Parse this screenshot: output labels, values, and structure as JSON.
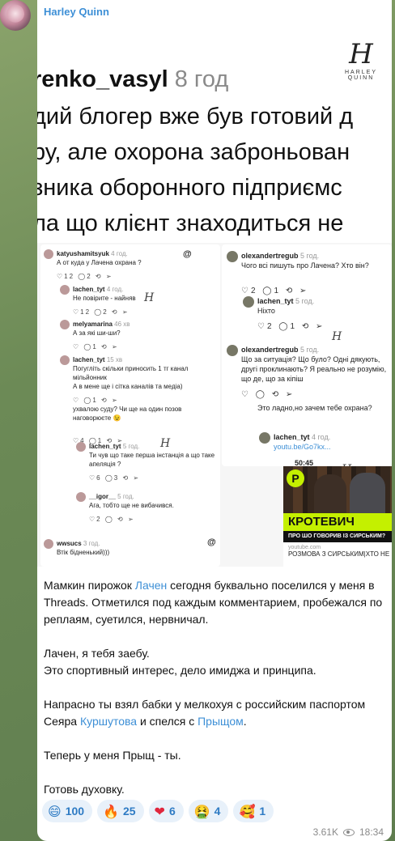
{
  "message": {
    "sender": "Harley Quinn",
    "views": "3.61K",
    "time": "18:34",
    "paragraphs": [
      {
        "parts": [
          "Мамкин пирожок ",
          "Лачен",
          " сегодня буквально поселился у меня в Threads. Отметился под каждым комментарием, пробежался по реплаям, суетился, нервничал."
        ]
      },
      {
        "lines": [
          "Лачен, я тебя заебу.",
          "Это спортивный интерес, дело имиджа и принципа."
        ]
      },
      {
        "parts": [
          "Напрасно ты взял бабки у мелкохуя с российским паспортом Сеяра ",
          "Куршутова",
          " и спелся с ",
          "Прыщом",
          "."
        ]
      },
      {
        "text": "Теперь у меня Прыщ - ты."
      },
      {
        "text": "Готовь духовку."
      }
    ],
    "reactions": [
      {
        "emoji": "😄",
        "count": "100"
      },
      {
        "emoji": "🔥",
        "count": "25"
      },
      {
        "emoji": "❤",
        "count": "6"
      },
      {
        "emoji": "🤮",
        "count": "4"
      },
      {
        "emoji": "🥰",
        "count": "1"
      }
    ]
  },
  "screenshot_top": {
    "user": "renko_vasyl",
    "time": "8 год",
    "lines": [
      "дий блогер вже був готовий д",
      "ру, але охорона заброньован",
      "зника оборонного підприємс",
      "ла що клієнт знаходиться не"
    ],
    "logo_letter": "H",
    "logo_name": "HARLEY QUINN"
  },
  "collage_left": [
    {
      "user": "katyushamitsyuk",
      "time": "4 год.",
      "text": "А от куда у Лачена охрана ?",
      "actions": "♡12 ◯2 ⟲ ➢"
    },
    {
      "user": "lachen_tyt",
      "time": "4 год.",
      "text": "Не повірите - найняв",
      "actions": "♡12 ◯2 ⟲ ➢"
    },
    {
      "user": "melyamarina",
      "time": "46 хв",
      "text": "А за які ши-ши?",
      "actions": "♡ ◯1 ⟲ ➢"
    },
    {
      "user": "lachen_tyt",
      "time": "15 хв",
      "text": "Погугліть скільки приносить 1 тг канал мільйонник\nА в мене ще і сітка каналів та медіа)",
      "actions": "♡ ◯1 ⟲ ➢"
    },
    {
      "user": "",
      "time": "",
      "text": "ухвалою суду? Чи ще на один позов наговорюєте 😉",
      "actions": "♡4 ◯1 ⟲ ➢"
    },
    {
      "user": "lachen_tyt",
      "time": "5 год.",
      "text": "Ти чув що таке перша інстанція а що таке апеляція ?",
      "actions": "♡6 ◯3 ⟲ ➢"
    },
    {
      "user": "__igor__",
      "time": "5 год.",
      "text": "Ага, тобто ще не вибачився.",
      "actions": "♡2 ◯ ⟲ ➢"
    },
    {
      "user": "wwsucs",
      "time": "3 год.",
      "text": "Втік бідненький)))",
      "actions": ""
    }
  ],
  "collage_right": [
    {
      "user": "olexandertregub",
      "time": "5 год.",
      "text": "Чого всі пишуть про Лачена? Хто він?",
      "actions": "♡2 ◯1 ⟲ ➢"
    },
    {
      "user": "lachen_tyt",
      "time": "5 год.",
      "text": "Ніхто",
      "actions": "♡2 ◯1 ⟲ ➢"
    },
    {
      "user": "olexandertregub",
      "time": "5 год.",
      "text": "Що за ситуація? Що було? Одні дякують, другі проклинають? Я реально не розумію, що де, що за кіпіш",
      "actions": "♡ ◯ ⟲ ➢"
    },
    {
      "user": "",
      "time": "",
      "text": "Это ладно,но зачем тебе охрана?",
      "actions": ""
    },
    {
      "user": "lachen_tyt",
      "time": "4 год.",
      "text": "youtu.be/Go7kx...",
      "actions": ""
    }
  ],
  "video": {
    "duration": "50:45",
    "logo": "P",
    "title": "КРОТЕВИЧ",
    "subtitle": "ПРО ШО ГОВОРИВ ІЗ СИРСЬКИМ?",
    "source": "youtube.com",
    "caption": "РОЗМОВА З СИРСЬКИМ|ХТО НЕ"
  },
  "colors": {
    "link": "#3d8fd6",
    "sender": "#3d8fd6",
    "reaction_bg": "#e8f1fa"
  }
}
